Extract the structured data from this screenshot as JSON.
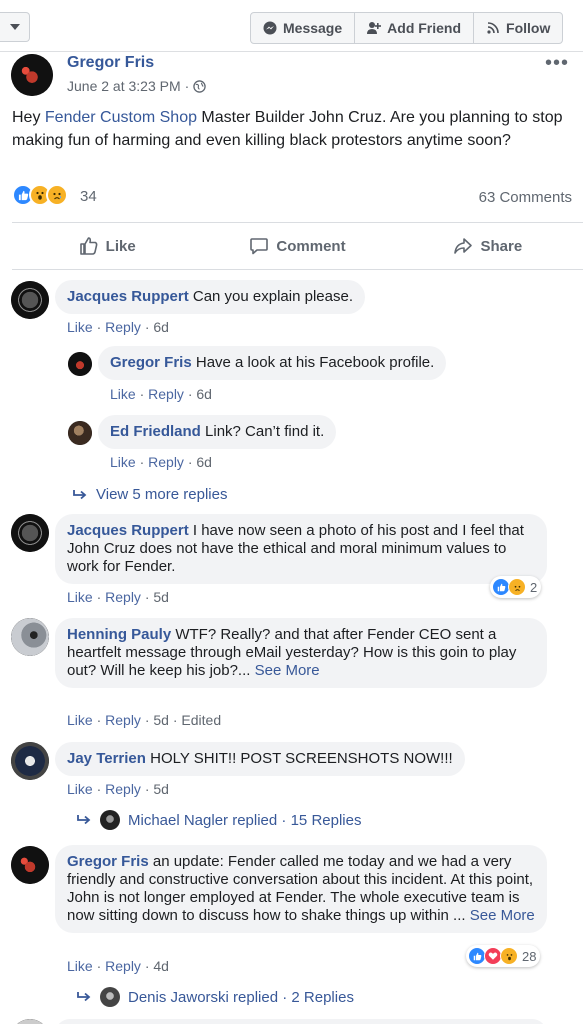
{
  "topbar": {
    "message_label": "Message",
    "add_friend_label": "Add Friend",
    "follow_label": "Follow"
  },
  "post": {
    "author": "Gregor Fris",
    "date": "June 2 at 3:23 PM",
    "text_before": "Hey ",
    "text_link": "Fender Custom Shop",
    "text_after": " Master Builder John Cruz. Are you planning to stop making fun of harming and even killing black protestors anytime soon?",
    "reaction_count": "34",
    "comments_count": "63 Comments",
    "like_label": "Like",
    "comment_label": "Comment",
    "share_label": "Share"
  },
  "comments": [
    {
      "author": "Jacques Ruppert",
      "text": "Can you explain please.",
      "like": "Like",
      "reply": "Reply",
      "time": "6d"
    },
    {
      "author": "Gregor Fris",
      "text": "Have a look at his Facebook profile.",
      "like": "Like",
      "reply": "Reply",
      "time": "6d"
    },
    {
      "author": "Ed Friedland",
      "text": "Link? Can’t find it.",
      "like": "Like",
      "reply": "Reply",
      "time": "6d"
    },
    {
      "author": "Jacques Ruppert",
      "text": "I have now seen a photo of his post and I feel that John Cruz does not have the ethical and moral minimum values to work for Fender.",
      "like": "Like",
      "reply": "Reply",
      "time": "5d",
      "reactions": "2"
    },
    {
      "author": "Henning Pauly",
      "text": "WTF? Really? and that after Fender CEO sent a heartfelt message through eMail yesterday? How is this goin to play out? Will he keep his job?...",
      "see_more": "See More",
      "like": "Like",
      "reply": "Reply",
      "time": "5d",
      "edited": "Edited"
    },
    {
      "author": "Jay Terrien",
      "text": "HOLY SHIT!! POST SCREENSHOTS NOW!!!",
      "like": "Like",
      "reply": "Reply",
      "time": "5d"
    },
    {
      "author": "Gregor Fris",
      "text": "an update: Fender called me today and we had a very friendly and constructive conversation about this incident. At this point, John is not longer employed at Fender. The whole executive team is now sitting down to discuss how to shake things up within ...",
      "see_more": "See More",
      "like": "Like",
      "reply": "Reply",
      "time": "4d",
      "reactions": "28"
    }
  ],
  "view_more": "View 5 more replies",
  "reply_summaries": [
    {
      "name": "Michael Nagler replied",
      "count": "15 Replies"
    },
    {
      "name": "Denis Jaworski replied",
      "count": "2 Replies"
    }
  ],
  "colors": {
    "link": "#365899",
    "bubble": "#f2f3f5",
    "like_blue": "#2d88ff"
  }
}
